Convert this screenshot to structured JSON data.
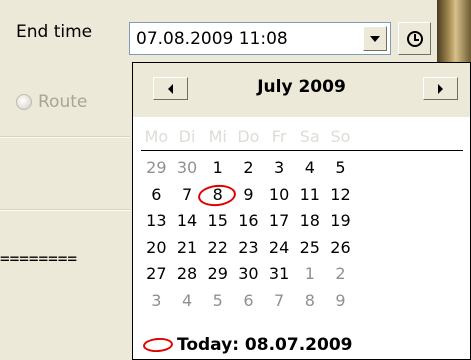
{
  "form": {
    "end_time_label": "End time",
    "end_time_value": "07.08.2009 11:08",
    "route_label": "Route",
    "dashes": "========"
  },
  "calendar": {
    "month_title": "July 2009",
    "weekdays": [
      "Mo",
      "Di",
      "Mi",
      "Do",
      "Fr",
      "Sa",
      "So"
    ],
    "weeks": [
      [
        {
          "d": "29",
          "other": true
        },
        {
          "d": "30",
          "other": true
        },
        {
          "d": "1"
        },
        {
          "d": "2"
        },
        {
          "d": "3"
        },
        {
          "d": "4"
        },
        {
          "d": "5"
        }
      ],
      [
        {
          "d": "6"
        },
        {
          "d": "7"
        },
        {
          "d": "8",
          "selected": true
        },
        {
          "d": "9"
        },
        {
          "d": "10"
        },
        {
          "d": "11"
        },
        {
          "d": "12"
        }
      ],
      [
        {
          "d": "13"
        },
        {
          "d": "14"
        },
        {
          "d": "15"
        },
        {
          "d": "16"
        },
        {
          "d": "17"
        },
        {
          "d": "18"
        },
        {
          "d": "19"
        }
      ],
      [
        {
          "d": "20"
        },
        {
          "d": "21"
        },
        {
          "d": "22"
        },
        {
          "d": "23"
        },
        {
          "d": "24"
        },
        {
          "d": "25"
        },
        {
          "d": "26"
        }
      ],
      [
        {
          "d": "27"
        },
        {
          "d": "28"
        },
        {
          "d": "29"
        },
        {
          "d": "30"
        },
        {
          "d": "31"
        },
        {
          "d": "1",
          "other": true
        },
        {
          "d": "2",
          "other": true
        }
      ],
      [
        {
          "d": "3",
          "other": true
        },
        {
          "d": "4",
          "other": true
        },
        {
          "d": "5",
          "other": true
        },
        {
          "d": "6",
          "other": true
        },
        {
          "d": "7",
          "other": true
        },
        {
          "d": "8",
          "other": true
        },
        {
          "d": "9",
          "other": true
        }
      ]
    ],
    "today_label": "Today: 08.07.2009"
  },
  "icons": {
    "dropdown": "chevron-down-icon",
    "clock": "clock-icon",
    "prev": "chevron-left-icon",
    "next": "chevron-right-icon"
  },
  "colors": {
    "window_bg": "#ece9d8",
    "annotation_red": "#e00000",
    "other_month_day": "#909090",
    "weekday_header": "#dedcd6"
  }
}
